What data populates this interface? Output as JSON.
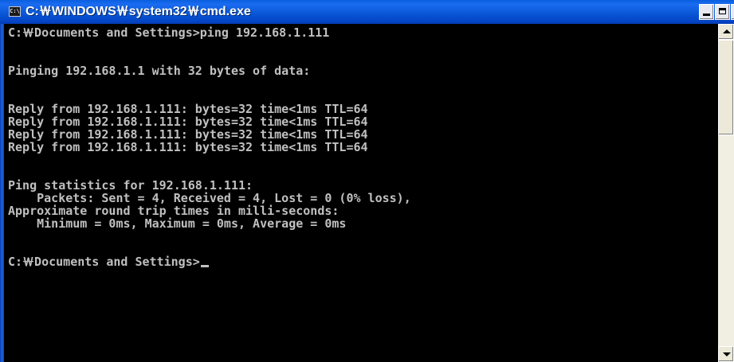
{
  "window": {
    "title": "C:￦WINDOWS￦system32￦cmd.exe",
    "icon": "console-icon",
    "icon_text": "C:\\",
    "buttons": {
      "minimize": "minimize-icon",
      "maximize": "maximize-icon",
      "close_label": "×"
    }
  },
  "console": {
    "lines": [
      "C:￦Documents and Settings>ping 192.168.1.111",
      "",
      "Pinging 192.168.1.1 with 32 bytes of data:",
      "",
      "Reply from 192.168.1.111: bytes=32 time<1ms TTL=64",
      "Reply from 192.168.1.111: bytes=32 time<1ms TTL=64",
      "Reply from 192.168.1.111: bytes=32 time<1ms TTL=64",
      "Reply from 192.168.1.111: bytes=32 time<1ms TTL=64",
      "",
      "Ping statistics for 192.168.1.111:",
      "    Packets: Sent = 4, Received = 4, Lost = 0 (0% loss),",
      "Approximate round trip times in milli-seconds:",
      "    Minimum = 0ms, Maximum = 0ms, Average = 0ms",
      "",
      "C:￦Documents and Settings>"
    ],
    "text_color": "#c0c0c0",
    "background": "#000000"
  },
  "colors": {
    "titlebar": "#0a58d8",
    "title_text": "#ffffff"
  }
}
